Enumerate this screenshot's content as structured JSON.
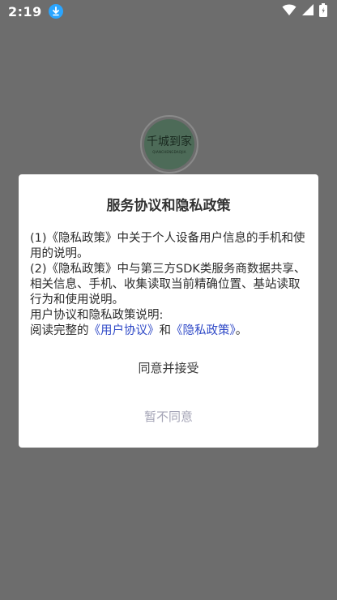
{
  "status_bar": {
    "time": "2:19",
    "icons": [
      "download-icon",
      "wifi-icon",
      "signal-icon",
      "battery-icon"
    ]
  },
  "splash": {
    "logo_text": "千城到家",
    "logo_subtext": "QIANCHENGDAOJIA"
  },
  "dialog": {
    "title": "服务协议和隐私政策",
    "para1": "(1)《隐私政策》中关于个人设备用户信息的手机和使用的说明。",
    "para2": "(2)《隐私政策》中与第三方SDK类服务商数据共享、相关信息、手机、收集读取当前精确位置、基站读取行为和使用说明。",
    "para3": "用户协议和隐私政策说明:",
    "para4_prefix": "阅读完整的",
    "user_agreement_link": "《用户协议》",
    "para4_and": "和",
    "privacy_policy_link": "《隐私政策》",
    "para4_suffix": "。",
    "agree_label": "同意并接受",
    "decline_label": "暂不同意"
  },
  "colors": {
    "overlay": "#6d6d6d",
    "link": "#2f49c7",
    "decline": "#a4a4b6",
    "logo_green": "#4d6b58"
  }
}
